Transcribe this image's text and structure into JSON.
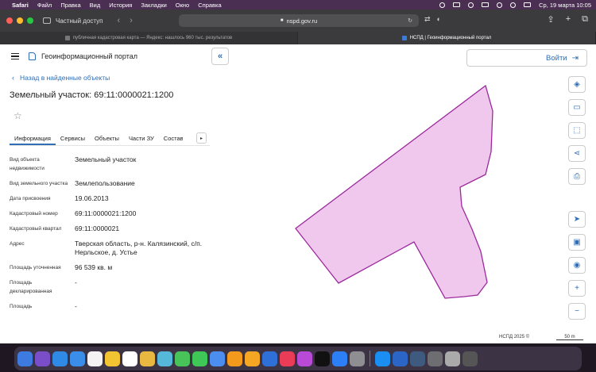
{
  "menubar": {
    "apple": "",
    "items": [
      "Safari",
      "Файл",
      "Правка",
      "Вид",
      "История",
      "Закладки",
      "Окно",
      "Справка"
    ],
    "clock": "Ср, 19 марта  10:05"
  },
  "browser": {
    "private_label": "Частный доступ",
    "url": "nspd.gov.ru",
    "tabs": [
      {
        "title": "публичная кадастровая карта — Яндекс: нашлось 960 тыс. результатов",
        "active": false
      },
      {
        "title": "НСПД | Геоинформационный портал",
        "active": true
      }
    ]
  },
  "portal": {
    "title": "Геоинформационный портал",
    "back_link": "Назад в найденные объекты",
    "object_title": "Земельный участок: 69:11:0000021:1200",
    "login_label": "Войти",
    "collapse_label": "«",
    "tab_scroll": "▸",
    "tabs": [
      "Информация",
      "Сервисы",
      "Объекты",
      "Части ЗУ",
      "Составные"
    ],
    "active_tab": "Информация",
    "properties": [
      {
        "label": "Вид объекта недвижимости",
        "value": "Земельный участок"
      },
      {
        "label": "Вид земельного участка",
        "value": "Землепользование"
      },
      {
        "label": "Дата присвоения",
        "value": "19.06.2013"
      },
      {
        "label": "Кадастровый номер",
        "value": "69:11:0000021:1200"
      },
      {
        "label": "Кадастровый квартал",
        "value": "69:11:0000021"
      },
      {
        "label": "Адрес",
        "value": "Тверская область, р-н. Калязинский, с/п. Нерльское, д. Устье"
      },
      {
        "label": "Площадь уточненная",
        "value": "96 539 кв. м"
      },
      {
        "label": "Площадь декларированная",
        "value": "-"
      },
      {
        "label": "Площадь",
        "value": "-"
      }
    ]
  },
  "map": {
    "parcel_fill": "#f0c8ee",
    "parcel_stroke": "#9b2a9c",
    "attribution": "НСПД 2025 ©",
    "scale_label": "50 m",
    "tools": [
      "layers-icon",
      "ruler-icon",
      "select-area-icon",
      "share-icon",
      "print-icon",
      "navigate-icon",
      "minimap-icon",
      "location-icon",
      "zoom-in-icon",
      "zoom-out-icon"
    ],
    "tool_glyphs": [
      "◈",
      "▭",
      "⬚",
      "⋖",
      "⎙",
      "➤",
      "▣",
      "◉",
      "+",
      "−"
    ]
  },
  "dock": {
    "colors": [
      "#3d7be0",
      "#7a4ec9",
      "#2f8ae6",
      "#3a8de8",
      "#f3f3f3",
      "#f3c432",
      "#ffffff",
      "#e8b840",
      "#55b8d8",
      "#48c35a",
      "#3ec756",
      "#4b8ef0",
      "#f39a1d",
      "#f5a623",
      "#2e6fd8",
      "#ea3b57",
      "#b94ad8",
      "#111111",
      "#2d7ff7",
      "#8e8e93",
      "#1a8ef2",
      "#2b66c6",
      "#3e5a7e",
      "#6d6d72",
      "#aaaaaa",
      "#555555"
    ]
  }
}
